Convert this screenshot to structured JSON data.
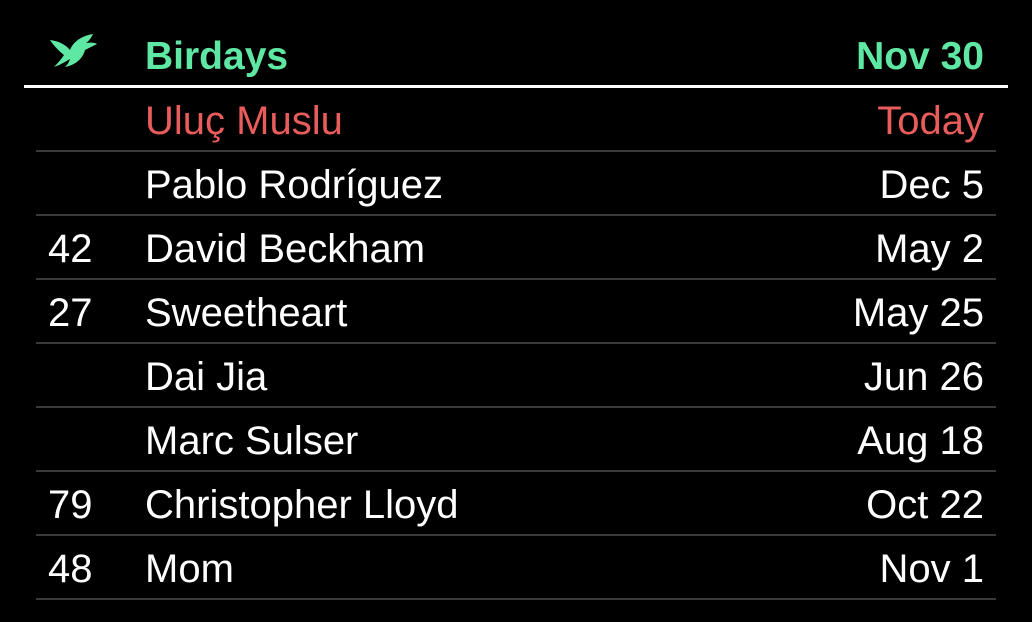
{
  "header": {
    "title": "Birdays",
    "date": "Nov 30",
    "logo_icon": "bird-icon",
    "accent_color": "#5ee8a3"
  },
  "highlight_color": "#e85c5c",
  "birthdays": [
    {
      "age": "",
      "name": "Uluç Muslu",
      "when": "Today",
      "highlight": true
    },
    {
      "age": "",
      "name": "Pablo Rodríguez",
      "when": "Dec 5",
      "highlight": false
    },
    {
      "age": "42",
      "name": "David Beckham",
      "when": "May 2",
      "highlight": false
    },
    {
      "age": "27",
      "name": "Sweetheart",
      "when": "May 25",
      "highlight": false
    },
    {
      "age": "",
      "name": "Dai Jia",
      "when": "Jun 26",
      "highlight": false
    },
    {
      "age": "",
      "name": "Marc Sulser",
      "when": "Aug 18",
      "highlight": false
    },
    {
      "age": "79",
      "name": "Christopher Lloyd",
      "when": "Oct 22",
      "highlight": false
    },
    {
      "age": "48",
      "name": "Mom",
      "when": "Nov 1",
      "highlight": false
    }
  ]
}
